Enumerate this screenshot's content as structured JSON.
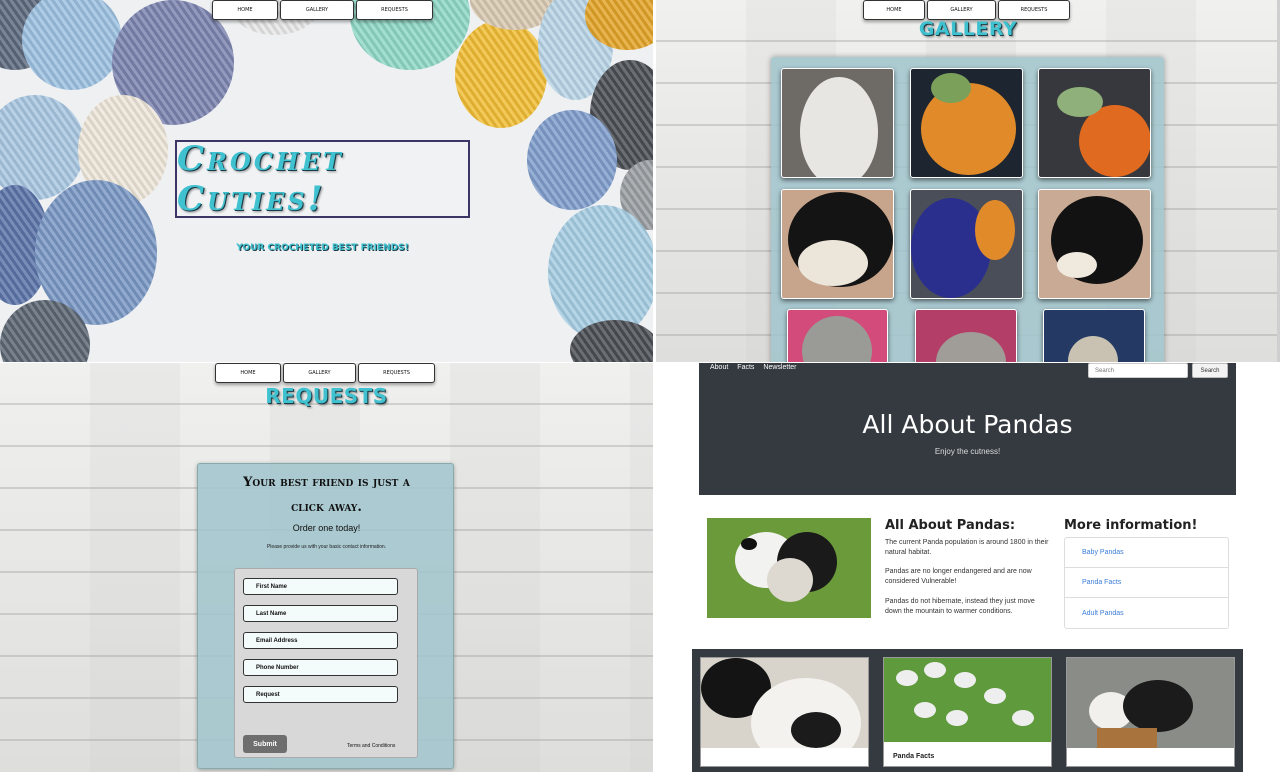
{
  "nav": {
    "home": "HOME",
    "gallery": "GALLERY",
    "requests": "REQUESTS"
  },
  "home": {
    "title": "Crochet Cuties!",
    "tagline": "YOUR CROCHETED BEST FRIENDS!"
  },
  "gallery": {
    "title": "GALLERY"
  },
  "requests": {
    "title": "REQUESTS",
    "heading_line1": "Your best friend is just a",
    "heading_line2": "click away.",
    "order": "Order one today!",
    "info": "Please provide us with your basic contact information.",
    "fields": [
      "First Name",
      "Last Name",
      "Email Address",
      "Phone Number",
      "Request"
    ],
    "submit": "Submit",
    "terms": "Terms and Conditions"
  },
  "pandas": {
    "nav": [
      "About",
      "Facts",
      "Newsletter"
    ],
    "search_placeholder": "Search",
    "search_button": "Search",
    "title": "All About Pandas",
    "subtitle": "Enjoy the cutness!",
    "about_heading": "All About Pandas:",
    "paragraphs": [
      "The current Panda population is around 1800 in their natural habitat.",
      "Pandas are no longer endangered and are now considered Vulnerable!",
      "Pandas do not hibernate, instead they just move down the mountain to warmer conditions."
    ],
    "more_heading": "More information!",
    "links": [
      "Baby Pandas",
      "Panda Facts",
      "Adult Pandas"
    ],
    "card_title": "Panda Facts"
  }
}
